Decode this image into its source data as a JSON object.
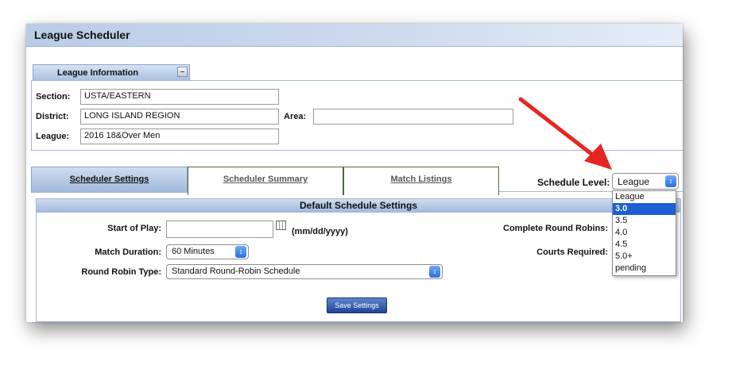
{
  "app": {
    "title": "League Scheduler"
  },
  "league_info": {
    "tab_label": "League Information",
    "section_label": "Section:",
    "section_value": "USTA/EASTERN",
    "district_label": "District:",
    "district_value": "LONG ISLAND REGION",
    "area_label": "Area:",
    "area_value": "",
    "league_label": "League:",
    "league_value": "2016 18&Over Men"
  },
  "tabs": [
    {
      "label": "Scheduler Settings",
      "active": true
    },
    {
      "label": "Scheduler Summary",
      "active": false
    },
    {
      "label": "Match Listings",
      "active": false
    }
  ],
  "schedule_level": {
    "label": "Schedule Level:",
    "selected": "League",
    "options": [
      "League",
      "3.0",
      "3.5",
      "4.0",
      "4.5",
      "5.0+",
      "pending"
    ],
    "highlighted": "3.0"
  },
  "settings": {
    "header": "Default Schedule Settings",
    "start_of_play_label": "Start of Play:",
    "start_of_play_value": "",
    "date_format": "(mm/dd/yyyy)",
    "match_duration_label": "Match Duration:",
    "match_duration_value": "60 Minutes",
    "round_robin_type_label": "Round Robin Type:",
    "round_robin_type_value": "Standard Round-Robin Schedule",
    "complete_round_robins_label": "Complete Round Robins:",
    "courts_required_label": "Courts Required:",
    "save_label": "Save Settings"
  },
  "colors": {
    "header_blue": "#b9cce6",
    "highlight": "#1c5fd2",
    "arrow": "#e52620"
  }
}
